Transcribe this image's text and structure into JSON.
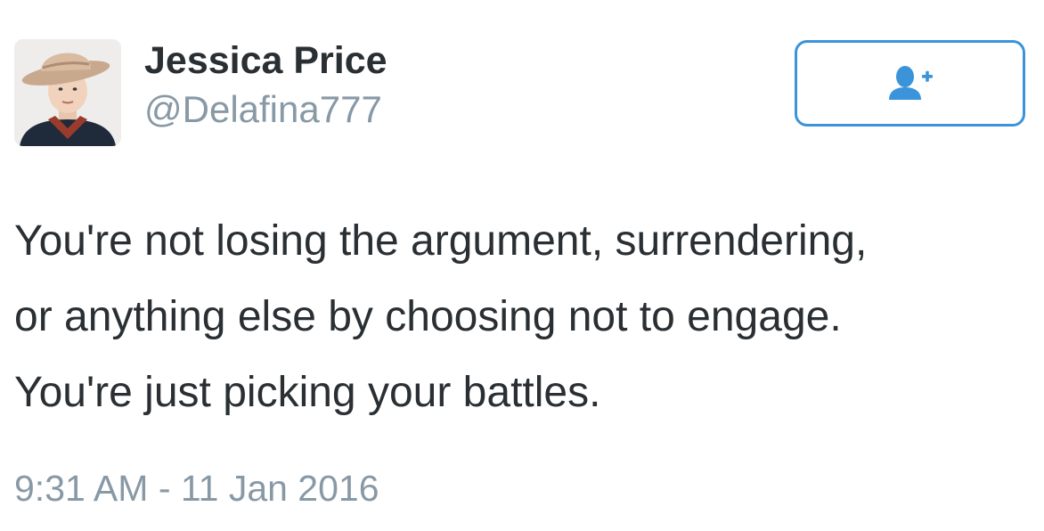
{
  "author": {
    "display_name": "Jessica Price",
    "handle": "@Delafina777",
    "avatar_icon": "profile-photo-woman-in-cowboy-hat"
  },
  "follow_button": {
    "icon": "follow-user-plus-icon",
    "color": "#3b94d9"
  },
  "tweet": {
    "lines": [
      "You're not losing the argument, surrendering,",
      "or anything else by choosing not to engage.",
      "You're just picking your battles."
    ],
    "timestamp": "9:31 AM - 11 Jan 2016"
  },
  "colors": {
    "name": "#292f33",
    "secondary": "#8899a6",
    "accent": "#3b94d9",
    "background": "#ffffff"
  }
}
